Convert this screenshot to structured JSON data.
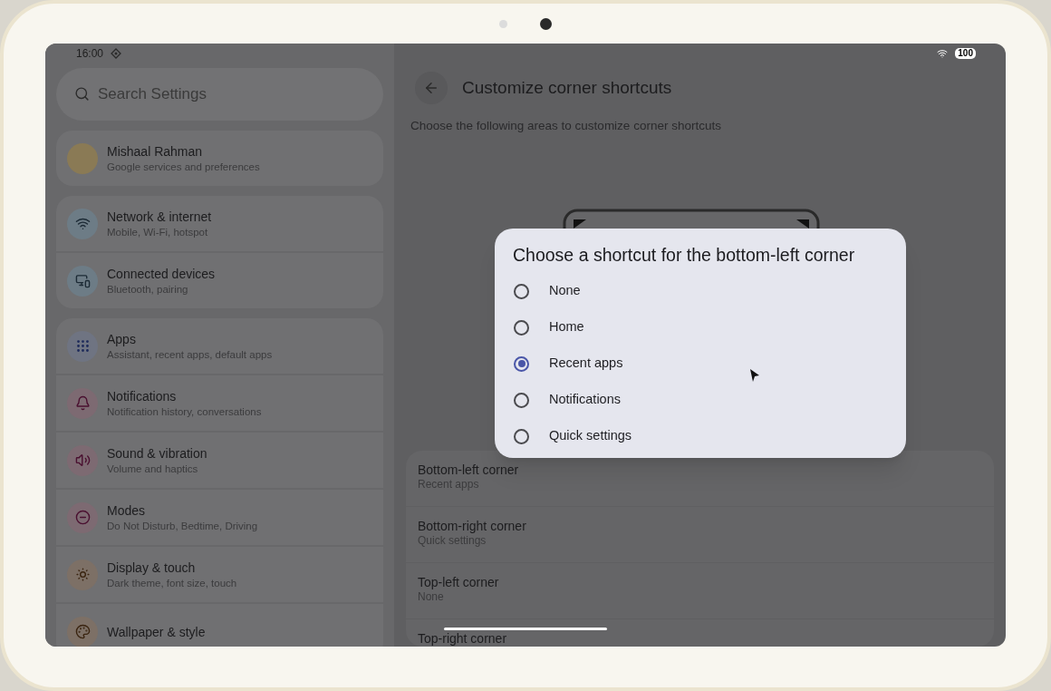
{
  "status_bar": {
    "time": "16:00",
    "battery": "100"
  },
  "search": {
    "placeholder": "Search Settings"
  },
  "sidebar": {
    "groups": [
      {
        "items": [
          {
            "kind": "profile",
            "title": "Mishaal Rahman",
            "subtitle": "Google services and preferences"
          }
        ]
      },
      {
        "items": [
          {
            "kind": "setting",
            "title": "Network & internet",
            "subtitle": "Mobile, Wi-Fi, hotspot"
          },
          {
            "kind": "setting",
            "title": "Connected devices",
            "subtitle": "Bluetooth, pairing"
          }
        ]
      },
      {
        "items": [
          {
            "kind": "setting",
            "title": "Apps",
            "subtitle": "Assistant, recent apps, default apps"
          },
          {
            "kind": "setting",
            "title": "Notifications",
            "subtitle": "Notification history, conversations"
          },
          {
            "kind": "setting",
            "title": "Sound & vibration",
            "subtitle": "Volume and haptics"
          },
          {
            "kind": "setting",
            "title": "Modes",
            "subtitle": "Do Not Disturb, Bedtime, Driving"
          },
          {
            "kind": "setting",
            "title": "Display & touch",
            "subtitle": "Dark theme, font size, touch"
          },
          {
            "kind": "setting",
            "title": "Wallpaper & style"
          }
        ]
      }
    ]
  },
  "page": {
    "title": "Customize corner shortcuts",
    "description": "Choose the following areas to customize corner shortcuts",
    "corners": [
      {
        "title": "Bottom-left corner",
        "value": "Recent apps"
      },
      {
        "title": "Bottom-right corner",
        "value": "Quick settings"
      },
      {
        "title": "Top-left corner",
        "value": "None"
      },
      {
        "title": "Top-right corner"
      }
    ]
  },
  "dialog": {
    "title": "Choose a shortcut for the bottom-left corner",
    "options": [
      {
        "label": "None",
        "selected": false
      },
      {
        "label": "Home",
        "selected": false
      },
      {
        "label": "Recent apps",
        "selected": true
      },
      {
        "label": "Notifications",
        "selected": false
      },
      {
        "label": "Quick settings",
        "selected": false
      }
    ]
  }
}
